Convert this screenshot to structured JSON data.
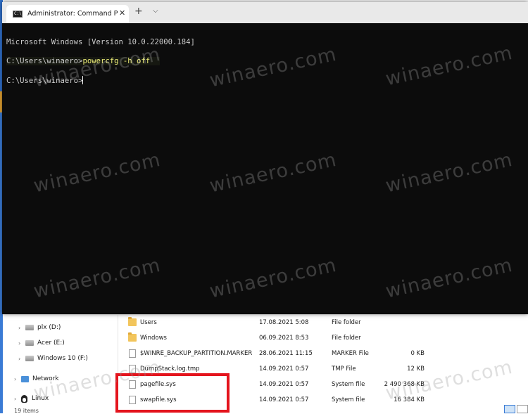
{
  "terminal": {
    "tab_title": "Administrator: Command Prompt",
    "tab_icon_text": "C:\\",
    "close_glyph": "✕",
    "new_tab_glyph": "+",
    "dropdown_glyph": "⌵",
    "lines": {
      "version": "Microsoft Windows [Version 10.0.22000.184]",
      "prompt1": "C:\\Users\\winaero>",
      "command": "powercfg -h off",
      "prompt2": "C:\\Users\\winaero>"
    }
  },
  "explorer": {
    "nav_items": [
      {
        "label": "plx (D:)",
        "icon": "drive-icon"
      },
      {
        "label": "Acer (E:)",
        "icon": "drive-icon"
      },
      {
        "label": "Windows 10 (F:)",
        "icon": "drive-icon"
      },
      {
        "label": "Network",
        "icon": "network-icon"
      },
      {
        "label": "Linux",
        "icon": "linux-icon"
      }
    ],
    "status": "19 items",
    "files": [
      {
        "name": "Users",
        "date": "17.08.2021 5:08",
        "type": "File folder",
        "size": "",
        "icon": "folder-icon"
      },
      {
        "name": "Windows",
        "date": "06.09.2021 8:53",
        "type": "File folder",
        "size": "",
        "icon": "folder-icon"
      },
      {
        "name": "$WINRE_BACKUP_PARTITION.MARKER",
        "date": "28.06.2021 11:15",
        "type": "MARKER File",
        "size": "0 KB",
        "icon": "file-icon"
      },
      {
        "name": "DumpStack.log.tmp",
        "date": "14.09.2021 0:57",
        "type": "TMP File",
        "size": "12 KB",
        "icon": "file-icon"
      },
      {
        "name": "pagefile.sys",
        "date": "14.09.2021 0:57",
        "type": "System file",
        "size": "2 490 368 KB",
        "icon": "file-icon"
      },
      {
        "name": "swapfile.sys",
        "date": "14.09.2021 0:57",
        "type": "System file",
        "size": "16 384 KB",
        "icon": "file-icon"
      }
    ]
  },
  "watermark": "winaero.com",
  "colors": {
    "console_bg": "#0c0c0c",
    "console_text": "#cccccc",
    "command_text": "#f0f07a",
    "highlight_box": "#e4141d",
    "folder": "#f2c55c"
  }
}
